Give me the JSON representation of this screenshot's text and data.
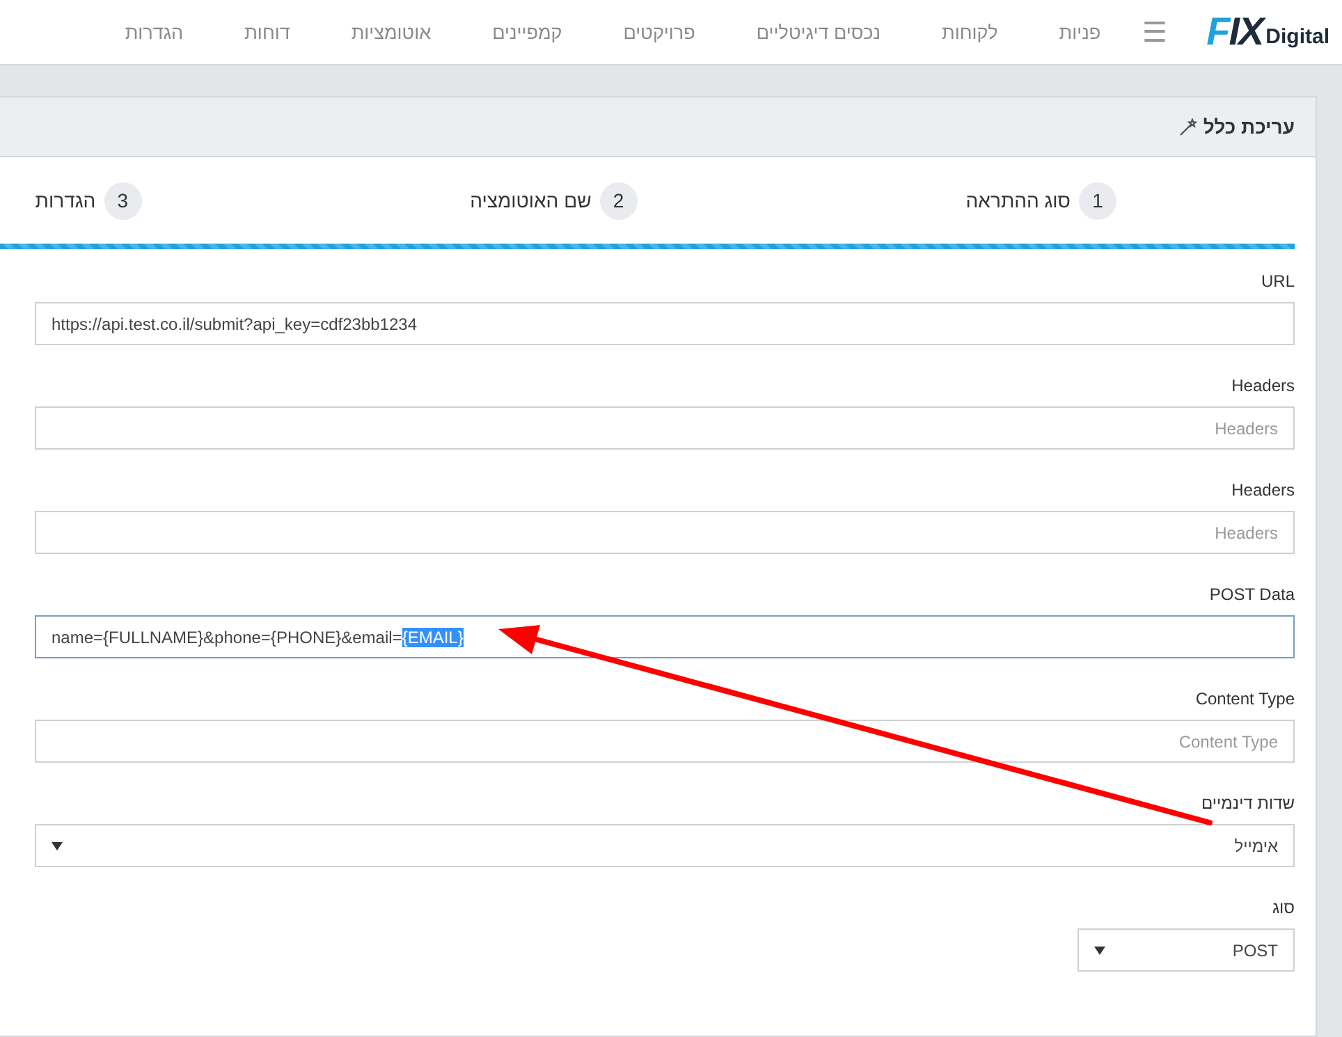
{
  "nav": {
    "logo": {
      "mark": "FIX",
      "word": "Digital"
    },
    "menu_glyph": "☰",
    "items": [
      "פניות",
      "לקוחות",
      "נכסים דיגיטליים",
      "פרויקטים",
      "קמפיינים",
      "אוטומציות",
      "דוחות",
      "הגדרות"
    ]
  },
  "panel": {
    "title": "עריכת כלל",
    "steps": [
      {
        "number": "1",
        "label": "סוג ההתראה"
      },
      {
        "number": "2",
        "label": "שם האוטומציה"
      },
      {
        "number": "3",
        "label": "הגדרות"
      }
    ],
    "progress": {
      "level": 1
    },
    "fields": [
      {
        "kind": "text",
        "label": "URL",
        "value": "https://api.test.co.il/submit?api_key=cdf23bb1234",
        "focused": false
      },
      {
        "kind": "text",
        "label": "Headers",
        "placeholder": "Headers",
        "focused": false
      },
      {
        "kind": "text",
        "label": "Headers",
        "placeholder": "Headers",
        "focused": false
      },
      {
        "kind": "text",
        "label": "POST Data",
        "value": "name={FULLNAME}&phone={PHONE}&email=",
        "selected_text": "{EMAIL}",
        "focused": true
      },
      {
        "kind": "text",
        "label": "Content Type",
        "placeholder": "Content Type",
        "focused": false
      },
      {
        "kind": "select",
        "label": "שדות דינמיים",
        "value": "אימייל"
      },
      {
        "kind": "compact-select",
        "label": "סוג",
        "value": "POST"
      }
    ]
  }
}
